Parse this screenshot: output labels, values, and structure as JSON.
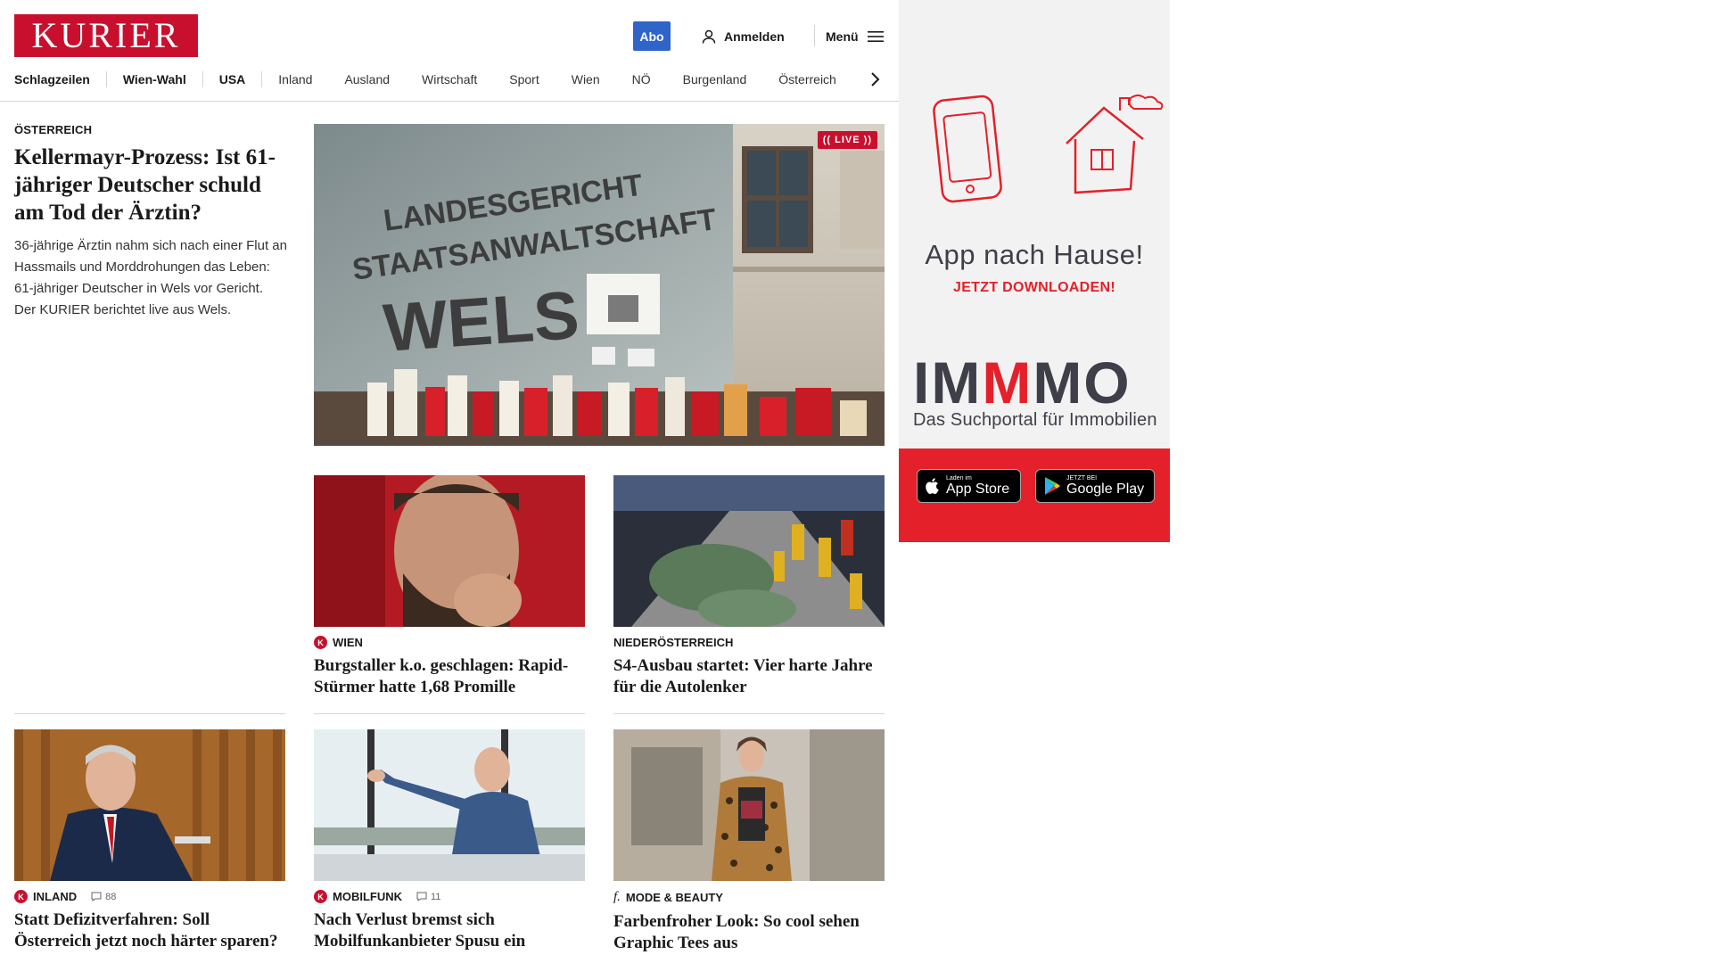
{
  "header": {
    "logo": "KURIER",
    "abo": "Abo",
    "login": "Anmelden",
    "menu": "Menü"
  },
  "nav": {
    "items": [
      "Schlagzeilen",
      "Wien-Wahl",
      "USA",
      "Inland",
      "Ausland",
      "Wirtschaft",
      "Sport",
      "Wien",
      "NÖ",
      "Burgenland",
      "Österreich"
    ]
  },
  "lead": {
    "kicker": "ÖSTERREICH",
    "title": "Kellermayr-Prozess: Ist 61-jähriger Deutscher schuld am Tod der Ärztin?",
    "description": "36-jährige Ärztin nahm sich nach einer Flut an Hassmails und Morddrohungen das Leben: 61-jähriger Deutscher in Wels vor Gericht. Der KURIER berichtet live aus Wels.",
    "badge": "LIVE",
    "image_text": {
      "line1": "LANDESGERICHT",
      "line2": "STAATSANWALTSCHAFT",
      "line3": "WELS"
    }
  },
  "articles": [
    {
      "badge": "K",
      "section": "WIEN",
      "title": "Burgstaller k.o. geschlagen: Rapid-Stürmer hatte 1,68 Promille"
    },
    {
      "section": "NIEDERÖSTERREICH",
      "title": "S4-Ausbau startet: Vier harte Jahre für die Autolenker"
    },
    {
      "badge": "K",
      "section": "INLAND",
      "comments": "88",
      "title": "Statt Defizitverfahren: Soll Österreich jetzt noch härter sparen?"
    },
    {
      "badge": "K",
      "section": "MOBILFUNK",
      "comments": "11",
      "title": "Nach Verlust bremst sich Mobilfunkanbieter Spusu ein"
    },
    {
      "badge": "f.",
      "section": "MODE & BEAUTY",
      "title": "Farbenfroher Look: So cool sehen Graphic Tees aus"
    }
  ],
  "ad": {
    "tagline": "App nach Hause!",
    "cta": "JETZT DOWNLOADEN!",
    "brand_1": "IM",
    "brand_2": "M",
    "brand_3": "MO",
    "brand_sub": "Das Suchportal für Immobilien",
    "appstore_small": "Laden im",
    "appstore_big": "App Store",
    "play_small": "JETZT BEI",
    "play_big": "Google Play"
  },
  "colors": {
    "brand_red": "#c8102e",
    "abo_blue": "#2f64c8",
    "ad_red": "#e4202a",
    "ad_text": "#3f3f4a"
  }
}
